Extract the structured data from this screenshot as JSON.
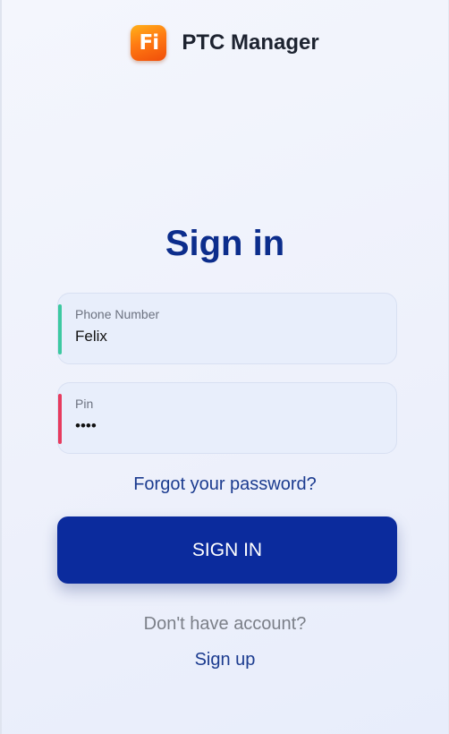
{
  "app": {
    "logo_text": "Fi",
    "name": "PTC Manager"
  },
  "form": {
    "title": "Sign in",
    "phone": {
      "label": "Phone Number",
      "value": "Felix",
      "accent_color": "#3dc9a1"
    },
    "pin": {
      "label": "Pin",
      "value": "••••",
      "accent_color": "#e73b5e"
    },
    "forgot_link": "Forgot your password?",
    "submit_label": "SIGN IN",
    "no_account_text": "Don't have account?",
    "signup_link": "Sign up"
  },
  "colors": {
    "primary": "#0b2b9d",
    "title": "#0c2d8c",
    "link": "#1b3b8f",
    "logo_gradient": [
      "#ffb21a",
      "#f04d0a"
    ]
  }
}
